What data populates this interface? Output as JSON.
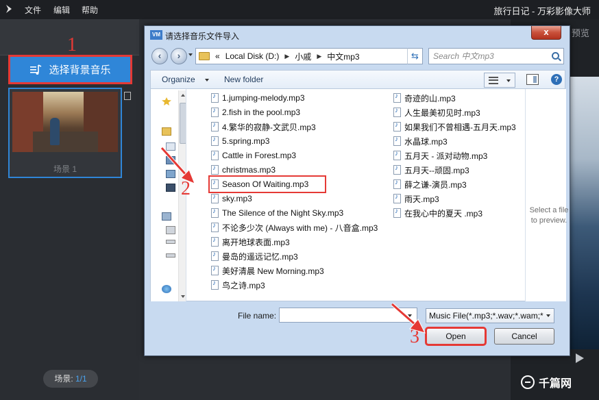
{
  "app": {
    "menu": [
      "文件",
      "编辑",
      "帮助"
    ],
    "title": "旅行日记 - 万彩影像大师"
  },
  "left_panel": {
    "select_music_label": "选择背景音乐",
    "scene_label": "场景 1",
    "scene_count_prefix": "场景: ",
    "scene_count_value": "1/1"
  },
  "preview": {
    "label": "预览"
  },
  "annotations": {
    "step1": "1",
    "step2": "2",
    "step3": "3",
    "color": "#e53935"
  },
  "watermark": "千篇网",
  "dialog": {
    "icon_text": "VM",
    "title": "请选择音乐文件导入",
    "close_label": "x",
    "address": {
      "prefix": "«",
      "segments": [
        "Local Disk (D:)",
        "小戚",
        "中文mp3"
      ]
    },
    "search_placeholder": "Search 中文mp3",
    "toolbar": {
      "organize": "Organize",
      "new_folder": "New folder",
      "help": "?"
    },
    "files_col1": [
      "1.jumping-melody.mp3",
      "2.fish in the pool.mp3",
      "4.繁华的寂静-文武贝.mp3",
      "5.spring.mp3",
      "Cattle in Forest.mp3",
      "christmas.mp3",
      "Season Of Waiting.mp3",
      "sky.mp3",
      "The Silence of the Night Sky.mp3",
      "不论多少次 (Always with me) - 八音盒.mp3",
      "离开地球表面.mp3",
      "曼岛的遥远记忆.mp3",
      "美好清晨 New Morning.mp3",
      "鸟之诗.mp3"
    ],
    "files_col2": [
      "奇迹的山.mp3",
      "人生最美初见时.mp3",
      "如果我们不曾相遇-五月天.mp3",
      "水晶球.mp3",
      "五月天 - 派对动物.mp3",
      "五月天--顽固.mp3",
      "薛之谦-演员.mp3",
      "雨天.mp3",
      "在我心中的夏天 .mp3"
    ],
    "highlighted_file": "Season Of Waiting.mp3",
    "preview_message": "Select a file to preview.",
    "file_name_label": "File name:",
    "file_name_value": "",
    "filter_value": "Music File(*.mp3;*.wav;*.wam;*",
    "open_label": "Open",
    "cancel_label": "Cancel"
  }
}
